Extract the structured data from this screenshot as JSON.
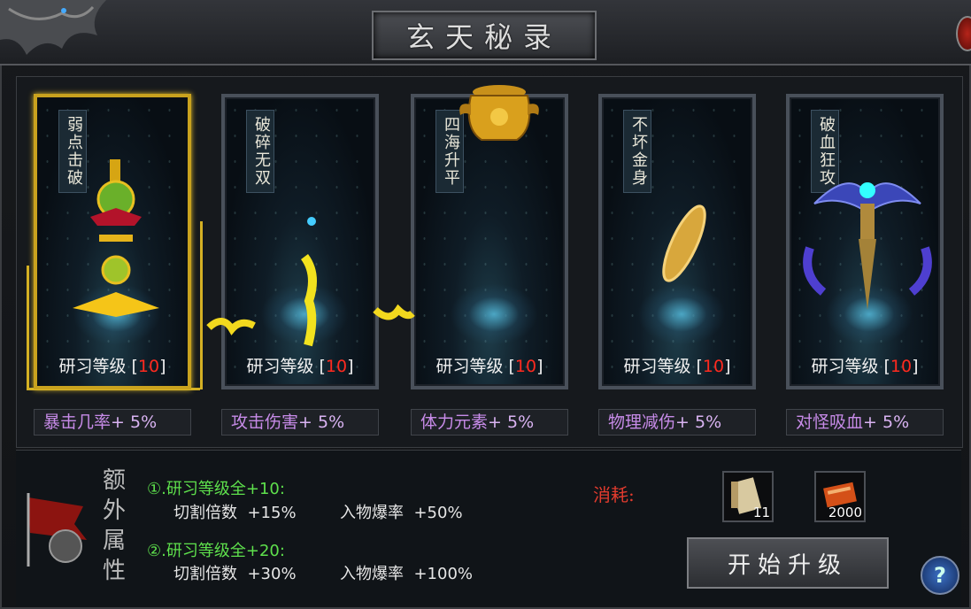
{
  "window": {
    "title": "玄天秘录"
  },
  "skills": [
    {
      "name": "弱点击破",
      "level_label": "研习等级",
      "level": "10",
      "stat_name": "暴击几率",
      "stat_value": "+ 5%"
    },
    {
      "name": "破碎无双",
      "level_label": "研习等级",
      "level": "10",
      "stat_name": "攻击伤害",
      "stat_value": "+ 5%"
    },
    {
      "name": "四海升平",
      "level_label": "研习等级",
      "level": "10",
      "stat_name": "体力元素",
      "stat_value": "+ 5%"
    },
    {
      "name": "不坏金身",
      "level_label": "研习等级",
      "level": "10",
      "stat_name": "物理减伤",
      "stat_value": "+ 5%"
    },
    {
      "name": "破血狂攻",
      "level_label": "研习等级",
      "level": "10",
      "stat_name": "对怪吸血",
      "stat_value": "+ 5%"
    }
  ],
  "extra": {
    "title": "额外属性",
    "bonuses": [
      {
        "heading": "①.研习等级全+10:",
        "stats": [
          {
            "name": "切割倍数",
            "value": "+15%"
          },
          {
            "name": "入物爆率",
            "value": "+50%"
          }
        ]
      },
      {
        "heading": "②.研习等级全+20:",
        "stats": [
          {
            "name": "切割倍数",
            "value": "+30%"
          },
          {
            "name": "入物爆率",
            "value": "+100%"
          }
        ]
      }
    ]
  },
  "cost": {
    "label": "消耗:",
    "items": [
      {
        "icon": "scroll-icon",
        "count": "11"
      },
      {
        "icon": "book-icon",
        "count": "2000"
      }
    ]
  },
  "upgrade_button": "开始升级",
  "colors": {
    "level_number": "#ff2a1f",
    "stat_text": "#c78be8",
    "bonus_heading": "#5ee04c",
    "cost_label": "#e23b2e",
    "selected_border": "#c9a21e"
  }
}
